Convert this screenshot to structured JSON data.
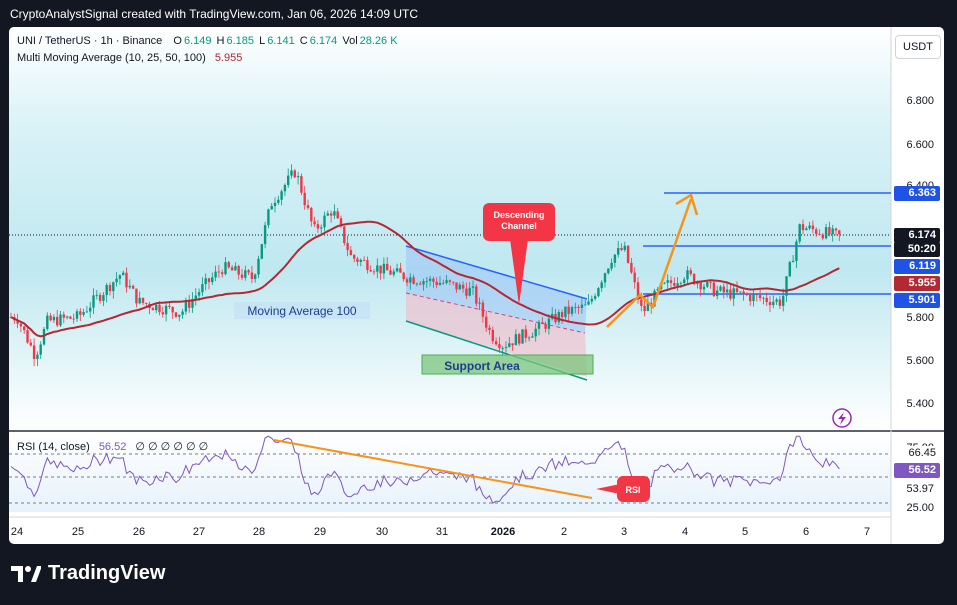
{
  "header": {
    "text": "CryptoAnalystSignal created with TradingView.com, Jan 06, 2026 14:09 UTC"
  },
  "symbol": {
    "name": "UNI / TetherUS · 1h · Binance",
    "o_label": "O",
    "o": "6.149",
    "h_label": "H",
    "h": "6.185",
    "l_label": "L",
    "l": "6.141",
    "c_label": "C",
    "c": "6.174",
    "vol_label": "Vol",
    "vol": "28.26 K"
  },
  "indicator": {
    "label": "Multi Moving Average (10, 25, 50, 100)",
    "value": "5.955"
  },
  "currency_button": "USDT",
  "rsi_legend": {
    "label": "RSI (14, close)",
    "value": "56.52",
    "extra": "∅ ∅ ∅ ∅ ∅ ∅"
  },
  "annotations": {
    "moving_average": "Moving Average 100",
    "support": "Support Area",
    "descending_line1": "Descending",
    "descending_line2": "Channel",
    "rsi": "RSI"
  },
  "price_badges": [
    {
      "text": "6.363",
      "color": "#1e53e5"
    },
    {
      "text": "6.174",
      "color": "#131722"
    },
    {
      "text": "50:20",
      "color": "#131722"
    },
    {
      "text": "6.119",
      "color": "#1e53e5"
    },
    {
      "text": "5.955",
      "color": "#b22833"
    },
    {
      "text": "5.901",
      "color": "#1e53e5"
    }
  ],
  "rsi_badges": [
    {
      "text": "66.45"
    },
    {
      "text": "56.52"
    }
  ],
  "logo": {
    "text": "TradingView"
  },
  "colors": {
    "up": "#089981",
    "down": "#f23645",
    "ma": "#b22833",
    "level": "#1e53e5",
    "rsi": "#7e57c2",
    "orange": "#f7931a",
    "callout": "#f23645"
  },
  "chart_data": {
    "type": "candlestick",
    "price_axis": {
      "ticks": [
        "6.800",
        "6.600",
        "6.400",
        "5.800",
        "5.600",
        "5.400"
      ],
      "ylim": [
        5.3,
        6.9
      ]
    },
    "rsi_axis": {
      "ticks": [
        "75.00",
        "66.45",
        "53.97",
        "25.00"
      ],
      "ylim": [
        20,
        80
      ]
    },
    "x_ticks": [
      "24",
      "25",
      "26",
      "27",
      "28",
      "29",
      "30",
      "31",
      "2026",
      "2",
      "3",
      "4",
      "5",
      "6",
      "7"
    ],
    "horizontal_levels": [
      6.363,
      6.119,
      5.901
    ],
    "last_price": 6.174,
    "ma100_last": 5.955,
    "rsi_last": 56.52,
    "rsi_levels": [
      66.45,
      53.97
    ],
    "price_path": [
      {
        "x": "24",
        "y": 5.8
      },
      {
        "x": "24.3",
        "y": 5.62
      },
      {
        "x": "24.5",
        "y": 5.78
      },
      {
        "x": "25",
        "y": 5.8
      },
      {
        "x": "25.7",
        "y": 6.0
      },
      {
        "x": "26",
        "y": 5.87
      },
      {
        "x": "26.7",
        "y": 5.82
      },
      {
        "x": "27",
        "y": 5.92
      },
      {
        "x": "27.4",
        "y": 6.03
      },
      {
        "x": "27.9",
        "y": 5.98
      },
      {
        "x": "28.2",
        "y": 6.33
      },
      {
        "x": "28.6",
        "y": 6.48
      },
      {
        "x": "28.9",
        "y": 6.2
      },
      {
        "x": "29.2",
        "y": 6.3
      },
      {
        "x": "29.5",
        "y": 6.08
      },
      {
        "x": "30",
        "y": 6.02
      },
      {
        "x": "30.5",
        "y": 5.98
      },
      {
        "x": "31",
        "y": 5.96
      },
      {
        "x": "31.5",
        "y": 5.92
      },
      {
        "x": "31.8",
        "y": 5.72
      },
      {
        "x": "2026",
        "y": 5.67
      },
      {
        "x": "1.6",
        "y": 5.75
      },
      {
        "x": "2",
        "y": 5.82
      },
      {
        "x": "2.4",
        "y": 5.85
      },
      {
        "x": "2.8",
        "y": 6.08
      },
      {
        "x": "3",
        "y": 6.12
      },
      {
        "x": "3.3",
        "y": 5.82
      },
      {
        "x": "3.6",
        "y": 5.93
      },
      {
        "x": "4",
        "y": 6.0
      },
      {
        "x": "4.5",
        "y": 5.92
      },
      {
        "x": "5",
        "y": 5.9
      },
      {
        "x": "5.6",
        "y": 5.87
      },
      {
        "x": "5.9",
        "y": 6.22
      },
      {
        "x": "6.2",
        "y": 6.2
      },
      {
        "x": "6.6",
        "y": 6.17
      }
    ]
  }
}
